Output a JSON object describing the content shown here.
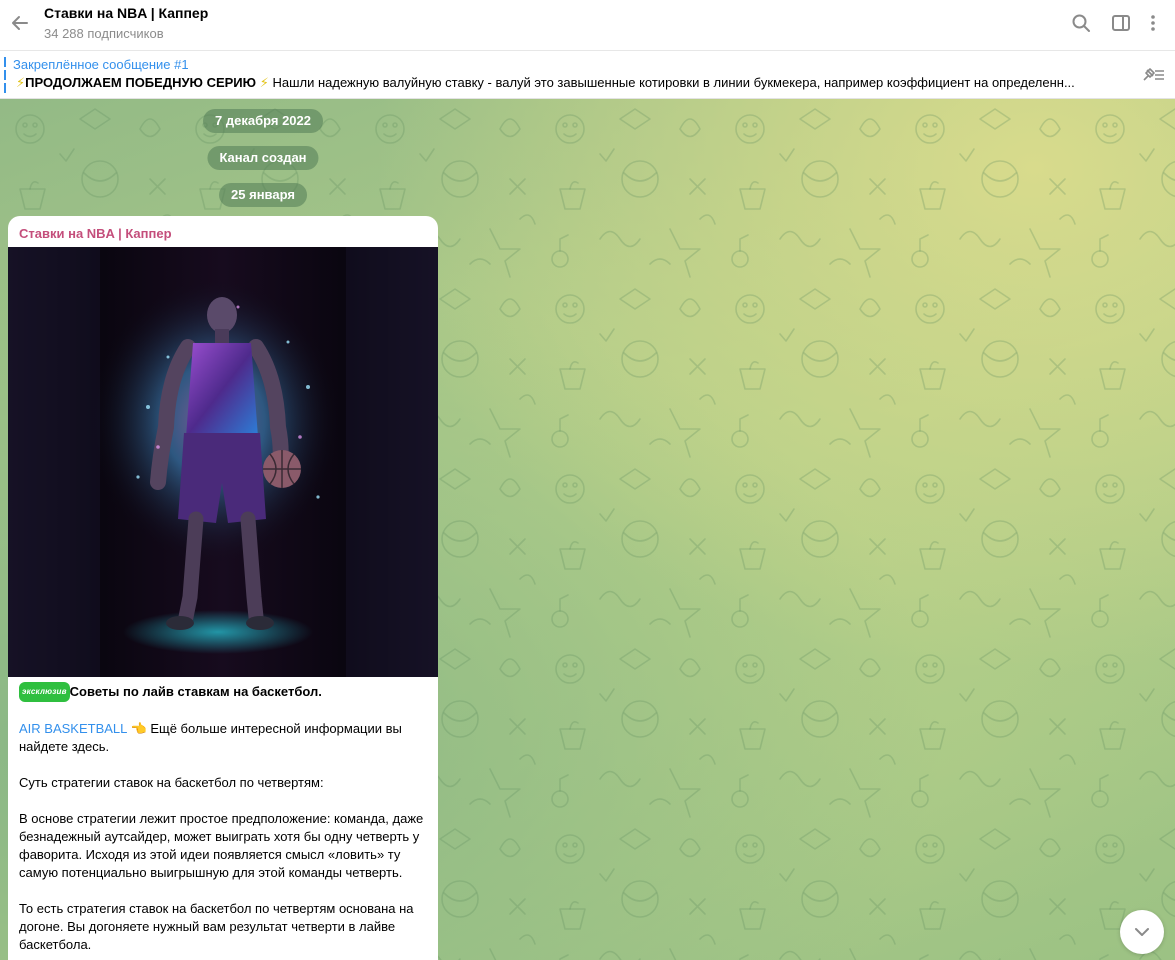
{
  "header": {
    "title": "Ставки на NBA | Каппер",
    "subscribers": "34 288 подписчиков"
  },
  "pinned": {
    "label": "Закреплённое сообщение #1",
    "bold_text": "ПРОДОЛЖАЕМ ПОБЕДНУЮ СЕРИЮ",
    "text": "Нашли надежную валуйную ставку - валуй это завышенные котировки в линии букмекера, например коэффициент на определенн..."
  },
  "chat": {
    "date_first": "7 декабря 2022",
    "service_created": "Канал создан",
    "date_second": "25 января"
  },
  "message": {
    "author": "Ставки на NBA | Каппер",
    "badge": "эксклюзив",
    "headline": "Советы по лайв ставкам на баскетбол.",
    "link_text": "AIR BASKETBALL",
    "link_emoji": "👈",
    "link_rest": "Ещё больше интересной информации вы найдете здесь.",
    "para2": "Суть стратегии ставок на баскетбол по четвертям:",
    "para3": "В основе стратегии лежит простое предположение: команда, даже безнадежный аутсайдер, может выиграть хотя бы одну четверть у фаворита. Исходя из этой идеи появляется смысл «ловить» ту самую потенциально выигрышную для этой команды четверть.",
    "para4": "То есть стратегия ставок на баскетбол по четвертям основана на догоне. Вы догоняете нужный вам результат четверти в лайве баскетбола."
  },
  "icons": {
    "back": "arrow-left-icon",
    "search": "search-icon",
    "sidebar": "sidebar-toggle-icon",
    "more": "more-vertical-icon",
    "pin_list": "pin-list-icon",
    "scroll": "chevron-down-icon"
  },
  "colors": {
    "accent": "#3390ec",
    "author": "#c44e7b",
    "badge": "#2fbf3f"
  }
}
